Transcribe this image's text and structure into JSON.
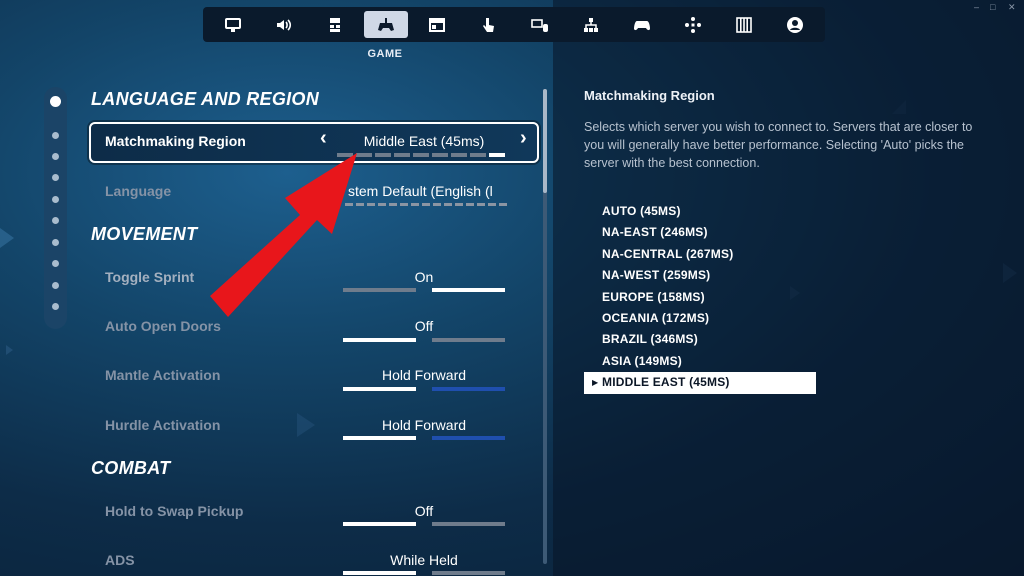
{
  "nav": {
    "items": [
      {
        "icon": "monitor-icon"
      },
      {
        "icon": "speaker-icon"
      },
      {
        "icon": "keyboard-layout-icon"
      },
      {
        "icon": "gamepad-icon",
        "active": true
      },
      {
        "icon": "window-icon"
      },
      {
        "icon": "touch-icon"
      },
      {
        "icon": "keyboard-mouse-icon"
      },
      {
        "icon": "network-icon"
      },
      {
        "icon": "controller-icon"
      },
      {
        "icon": "dpad-icon"
      },
      {
        "icon": "equalizer-icon"
      },
      {
        "icon": "account-icon"
      }
    ],
    "active_title": "GAME"
  },
  "window_controls": [
    "‒",
    "□",
    "✕"
  ],
  "sections": {
    "language": {
      "title": "LANGUAGE AND REGION",
      "matchmaking": {
        "label": "Matchmaking Region",
        "value": "Middle East (45ms)",
        "left_arrow": "‹",
        "right_arrow": "›",
        "segments": 9,
        "selected_segment": 9
      },
      "language": {
        "label": "Language",
        "value": "stem Default (English (l"
      }
    },
    "movement": {
      "title": "MOVEMENT",
      "toggle_sprint": {
        "label": "Toggle Sprint",
        "value": "On"
      },
      "auto_open_doors": {
        "label": "Auto Open Doors",
        "value": "Off"
      },
      "mantle_activation": {
        "label": "Mantle Activation",
        "value": "Hold Forward"
      },
      "hurdle_activation": {
        "label": "Hurdle Activation",
        "value": "Hold Forward"
      }
    },
    "combat": {
      "title": "COMBAT",
      "hold_to_swap": {
        "label": "Hold to Swap Pickup",
        "value": "Off"
      },
      "ads": {
        "label": "ADS",
        "value": "While Held"
      }
    }
  },
  "info": {
    "title": "Matchmaking Region",
    "description": "Selects which server you wish to connect to. Servers that are closer to you will generally have better performance. Selecting 'Auto' picks the server with the best connection.",
    "regions": [
      "AUTO (45MS)",
      "NA-EAST (246MS)",
      "NA-CENTRAL (267MS)",
      "NA-WEST (259MS)",
      "EUROPE (158MS)",
      "OCEANIA (172MS)",
      "BRAZIL (346MS)",
      "ASIA (149MS)",
      "MIDDLE EAST (45MS)"
    ],
    "selected_region_index": 8,
    "selected_marker": "▶"
  },
  "colors": {
    "annotation_arrow": "#e8161b",
    "bar_on": "#ffffff",
    "bar_off": "#6f7c8c",
    "bar_blue": "#1f4fae"
  }
}
